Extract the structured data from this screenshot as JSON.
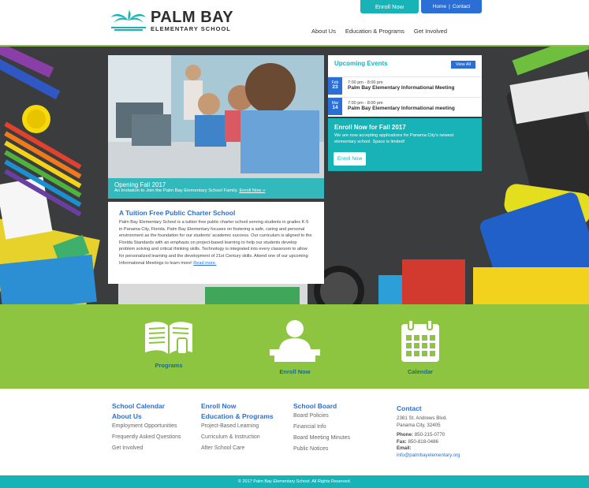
{
  "header": {
    "logo_name": "PALM BAY",
    "logo_sub": "ELEMENTARY SCHOOL",
    "enroll_label": "Enroll Now",
    "util_home": "Home",
    "util_sep": "|",
    "util_contact": "Contact",
    "nav": [
      "About Us",
      "Education & Programs",
      "Get Involved"
    ]
  },
  "hero": {
    "caption_title": "Opening Fall 2017",
    "caption_sub": "An Invitation to Join the Palm Bay Elementary School Family.",
    "caption_link": "Enroll Now »",
    "about_title": "A Tuition Free Public Charter School",
    "about_text": "Palm Bay Elementary School is a tuition free public charter school serving students in grades K-5 in Panama City, Florida. Palm Bay Elementary focuses on fostering a safe, caring and personal environment as the foundation for our students' academic success. Our curriculum is aligned to the Florida Standards with an emphasis on project-based learning to help our students develop problem solving and critical thinking skills. Technology is integrated into every classroom to allow for personalized learning and the development of 21st Century skills. Attend one of our upcoming Informational Meetings to learn more!",
    "about_read": "Read more.",
    "events_title": "Upcoming Events",
    "view_all": "View All",
    "events": [
      {
        "month": "Feb",
        "day": "23",
        "time": "7:00 pm - 8:00 pm",
        "title": "Palm Bay Elementary Informational Meeting"
      },
      {
        "month": "Mar",
        "day": "14",
        "time": "7:00 pm - 8:00 pm",
        "title": "Palm Bay Elementary Informational meeting"
      }
    ],
    "enroll_title": "Enroll Now for Fall 2017",
    "enroll_text": "We are now accepting applications for Panama City's newest elementary school. Space is limited!",
    "enroll_button": "Enroll Now"
  },
  "band": {
    "programs": "Programs",
    "enroll": "Enroll Now",
    "calendar": "Calendar"
  },
  "footer": {
    "col1": {
      "head1": "School Calendar",
      "head2": "About Us",
      "links": [
        "Employment Opportunities",
        "Frequently Asked Questions",
        "Get Involved"
      ]
    },
    "col2": {
      "head1": "Enroll Now",
      "head2": "Education & Programs",
      "links": [
        "Project-Based Learning",
        "Curriculum & Instruction",
        "After School Care"
      ]
    },
    "col3": {
      "head1": "School Board",
      "links": [
        "Board Policies",
        "Financial Info",
        "Board Meeting Minutes",
        "Public Notices"
      ]
    },
    "contact": {
      "head": "Contact",
      "address1": "2381 St. Andrews Blvd.",
      "address2": "Panama City, 32405",
      "phone_label": "Phone:",
      "phone": "850-215-0770",
      "fax_label": "Fax:",
      "fax": "850-818-0486",
      "email_label": "Email:",
      "email": "info@palmbayelementary.org"
    },
    "copyright": "© 2017 Palm Bay Elementary School. All Rights Reserved."
  },
  "colors": {
    "teal": "#17b3b7",
    "blue": "#2b6fd6",
    "green": "#8dc540",
    "band_text": "#176b8a"
  }
}
